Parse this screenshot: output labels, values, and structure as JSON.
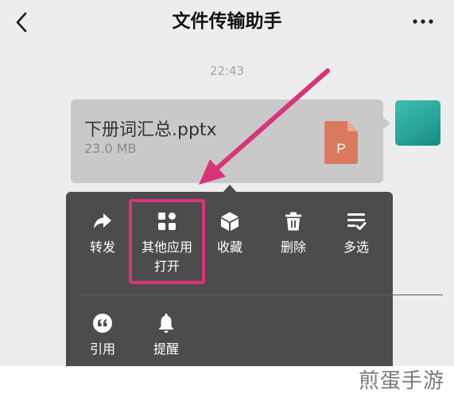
{
  "header": {
    "back_icon": "chevron-left-icon",
    "title": "文件传输助手",
    "more_icon": "ellipsis-icon"
  },
  "chat": {
    "timestamp": "22:43",
    "message": {
      "file_name": "下册词汇总.pptx",
      "file_size": "23.0 MB",
      "file_icon": "ppt-file-icon",
      "file_icon_letter": "P",
      "file_icon_color": "#d97a5e"
    }
  },
  "context_menu": {
    "items": [
      {
        "label": "转发",
        "icon": "share-arrow-icon"
      },
      {
        "label": "其他应用\n打开",
        "icon": "grid-apps-icon"
      },
      {
        "label": "收藏",
        "icon": "cube-icon"
      },
      {
        "label": "删除",
        "icon": "trash-icon"
      },
      {
        "label": "多选",
        "icon": "checklist-icon"
      },
      {
        "label": "引用",
        "icon": "quote-icon"
      },
      {
        "label": "提醒",
        "icon": "bell-icon"
      }
    ],
    "highlight_color": "#d8347a"
  },
  "watermark": "煎蛋手游"
}
